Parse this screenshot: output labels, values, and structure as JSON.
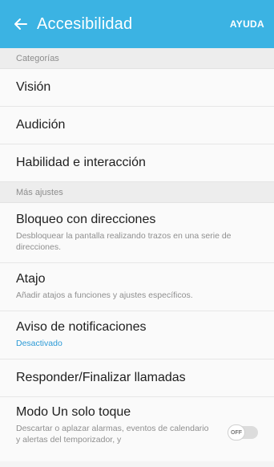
{
  "appbar": {
    "back_icon": "arrow-left-icon",
    "title": "Accesibilidad",
    "help_label": "AYUDA",
    "color": "#3bb3e3"
  },
  "sections": {
    "categorias": "Categorías",
    "mas_ajustes": "Más ajustes"
  },
  "items": {
    "vision": "Visión",
    "audicion": "Audición",
    "habilidad": "Habilidad e interacción",
    "bloqueo": {
      "title": "Bloqueo con direcciones",
      "subtitle": "Desbloquear la pantalla realizando trazos en una serie de direcciones."
    },
    "atajo": {
      "title": "Atajo",
      "subtitle": "Añadir atajos a funciones y ajustes específicos."
    },
    "aviso": {
      "title": "Aviso de notificaciones",
      "subtitle": "Desactivado"
    },
    "responder": "Responder/Finalizar llamadas",
    "modo": {
      "title": "Modo Un solo toque",
      "subtitle": "Descartar o aplazar alarmas, eventos de calendario y alertas del temporizador, y",
      "toggle_label": "OFF",
      "toggle_on": false
    }
  }
}
